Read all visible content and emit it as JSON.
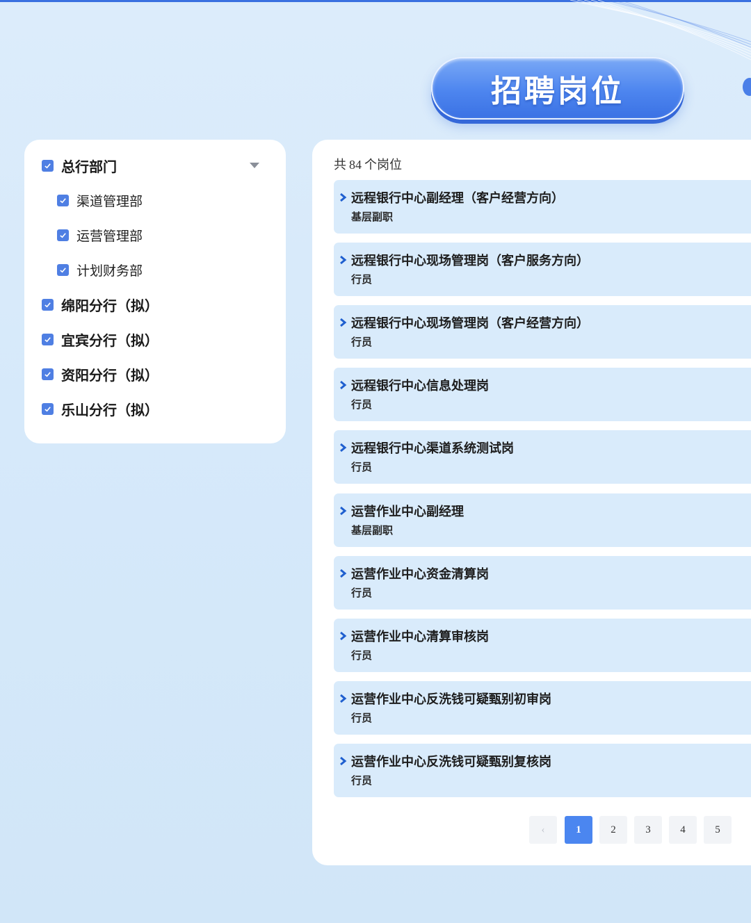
{
  "header": {
    "title": "招聘岗位"
  },
  "filters": {
    "items": [
      {
        "label": "总行部门",
        "checked": true,
        "level": 0
      },
      {
        "label": "渠道管理部",
        "checked": true,
        "level": 1
      },
      {
        "label": "运营管理部",
        "checked": true,
        "level": 1
      },
      {
        "label": "计划财务部",
        "checked": true,
        "level": 1
      },
      {
        "label": "绵阳分行（拟）",
        "checked": true,
        "level": 0
      },
      {
        "label": "宜宾分行（拟）",
        "checked": true,
        "level": 0
      },
      {
        "label": "资阳分行（拟）",
        "checked": true,
        "level": 0
      },
      {
        "label": "乐山分行（拟）",
        "checked": true,
        "level": 0
      }
    ]
  },
  "results": {
    "prefix": "共",
    "count": "84",
    "suffix": "个岗位",
    "jobs": [
      {
        "title": "远程银行中心副经理（客户经营方向）",
        "level": "基层副职"
      },
      {
        "title": "远程银行中心现场管理岗（客户服务方向）",
        "level": "行员"
      },
      {
        "title": "远程银行中心现场管理岗（客户经营方向）",
        "level": "行员"
      },
      {
        "title": "远程银行中心信息处理岗",
        "level": "行员"
      },
      {
        "title": "远程银行中心渠道系统测试岗",
        "level": "行员"
      },
      {
        "title": "运营作业中心副经理",
        "level": "基层副职"
      },
      {
        "title": "运营作业中心资金清算岗",
        "level": "行员"
      },
      {
        "title": "运营作业中心清算审核岗",
        "level": "行员"
      },
      {
        "title": "运营作业中心反洗钱可疑甄别初审岗",
        "level": "行员"
      },
      {
        "title": "运营作业中心反洗钱可疑甄别复核岗",
        "level": "行员"
      }
    ]
  },
  "pagination": {
    "prev": "‹",
    "pages": [
      "1",
      "2",
      "3",
      "4",
      "5"
    ],
    "current": "1"
  },
  "colors": {
    "accent": "#4b86f0",
    "checkbox": "#4f7fe3",
    "job_card": "#d9ebfb"
  }
}
